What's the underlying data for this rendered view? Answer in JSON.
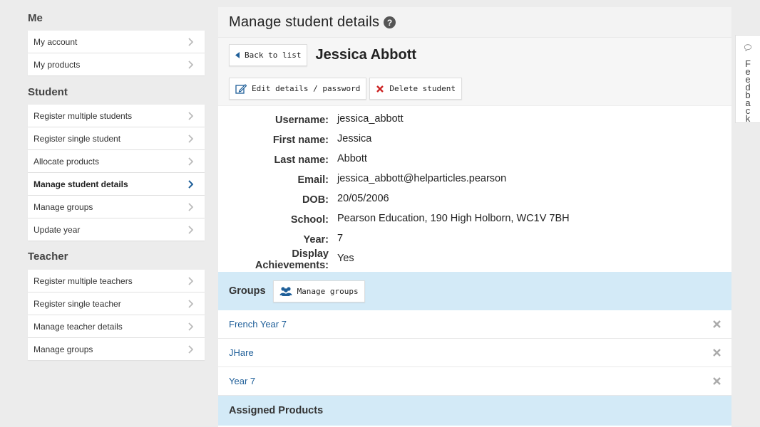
{
  "sidebar": {
    "me_heading": "Me",
    "me_items": [
      {
        "label": "My account"
      },
      {
        "label": "My products"
      }
    ],
    "student_heading": "Student",
    "student_items": [
      {
        "label": "Register multiple students"
      },
      {
        "label": "Register single student"
      },
      {
        "label": "Allocate products"
      },
      {
        "label": "Manage student details"
      },
      {
        "label": "Manage groups"
      },
      {
        "label": "Update year"
      }
    ],
    "teacher_heading": "Teacher",
    "teacher_items": [
      {
        "label": "Register multiple teachers"
      },
      {
        "label": "Register single teacher"
      },
      {
        "label": "Manage teacher details"
      },
      {
        "label": "Manage groups"
      }
    ]
  },
  "main": {
    "title": "Manage student details",
    "back_label": "Back to list",
    "student_name": "Jessica Abbott",
    "edit_label": "Edit details / password",
    "delete_label": "Delete student",
    "details": [
      {
        "label": "Username:",
        "value": "jessica_abbott"
      },
      {
        "label": "First name:",
        "value": "Jessica"
      },
      {
        "label": "Last name:",
        "value": "Abbott"
      },
      {
        "label": "Email:",
        "value": "jessica_abbott@helparticles.pearson"
      },
      {
        "label": "DOB:",
        "value": "20/05/2006"
      },
      {
        "label": "School:",
        "value": "Pearson Education, 190 High Holborn, WC1V 7BH"
      },
      {
        "label": "Year:",
        "value": "7"
      },
      {
        "label": "Display Achievements:",
        "value": "Yes"
      }
    ],
    "groups_heading": "Groups",
    "manage_groups_label": "Manage groups",
    "groups": [
      {
        "name": "French Year 7"
      },
      {
        "name": "JHare"
      },
      {
        "name": "Year 7"
      }
    ],
    "products_heading": "Assigned Products"
  },
  "feedback": {
    "letters": [
      "F",
      "e",
      "e",
      "d",
      "b",
      "a",
      "c",
      "k"
    ]
  },
  "colors": {
    "accent_blue_bg": "#d3eaf7",
    "link_blue": "#1f5f99",
    "delete_red": "#cc2222"
  }
}
